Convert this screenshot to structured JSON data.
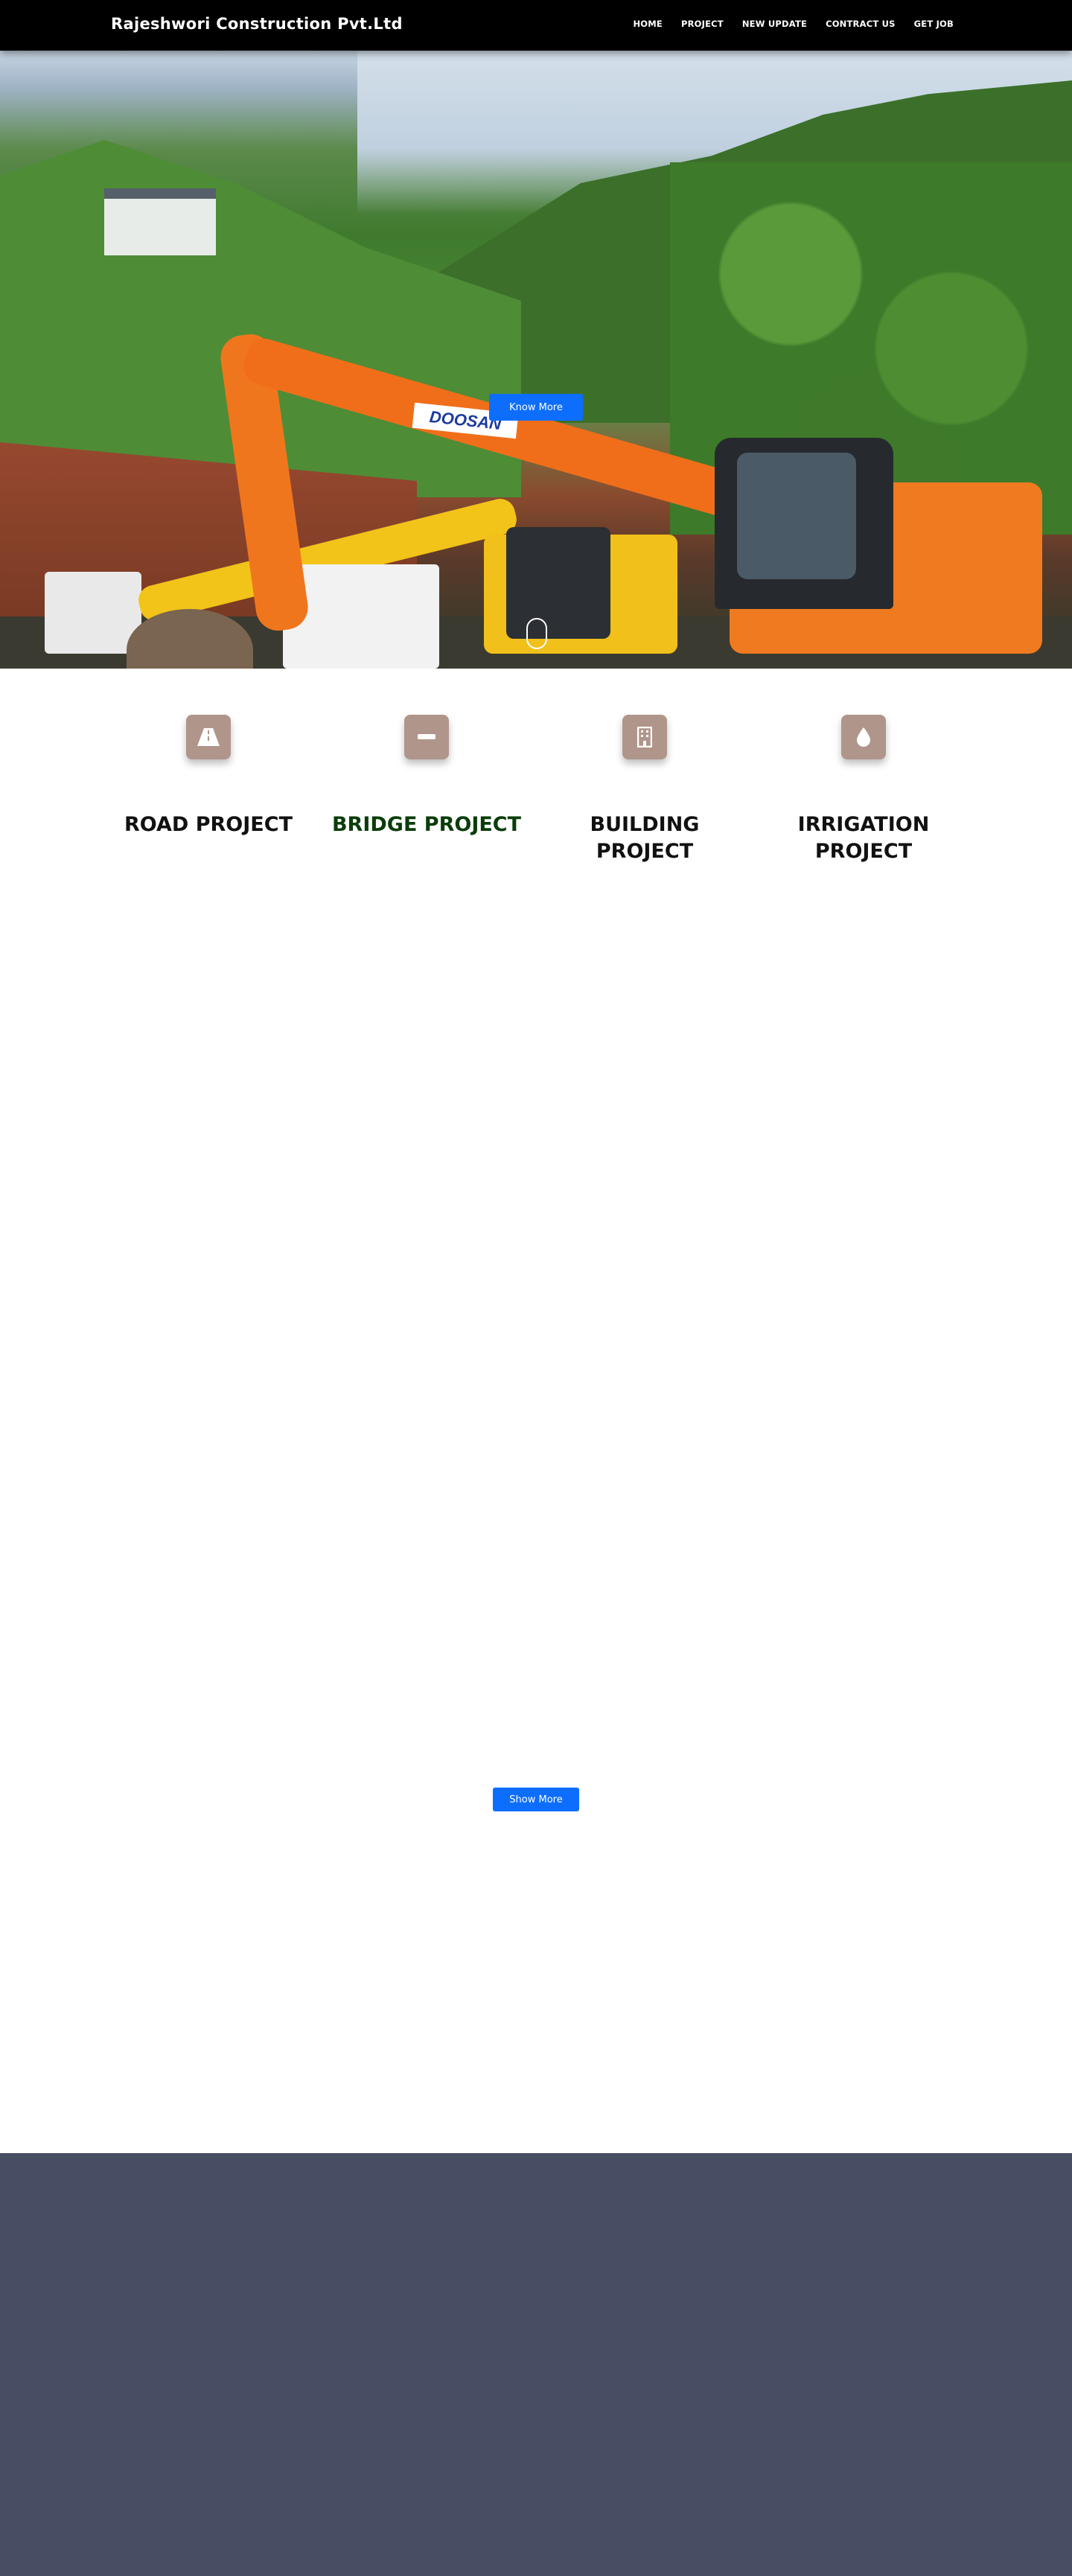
{
  "navbar": {
    "brand": "Rajeshwori Construction Pvt.Ltd",
    "links": [
      "HOME",
      "PROJECT",
      "NEW UPDATE",
      "CONTRACT US",
      "GET JOB"
    ]
  },
  "hero": {
    "button_label": "Know More",
    "excavator_logo": "DOOSAN"
  },
  "features": [
    {
      "title": "ROAD PROJECT",
      "icon": "road-icon"
    },
    {
      "title": "BRIDGE PROJECT",
      "icon": "minus-icon"
    },
    {
      "title": "BUILDING PROJECT",
      "icon": "building-icon"
    },
    {
      "title": "IRRIGATION PROJECT",
      "icon": "water-drop-icon"
    }
  ],
  "show_more_label": "Show More",
  "colors": {
    "navbar": "#000000",
    "accent": "#0d6efd",
    "icon_tile": "#b0958a",
    "footer": "#474e64",
    "wave_blue": "#3f6fd8",
    "wave_pink": "#f05fb8"
  }
}
